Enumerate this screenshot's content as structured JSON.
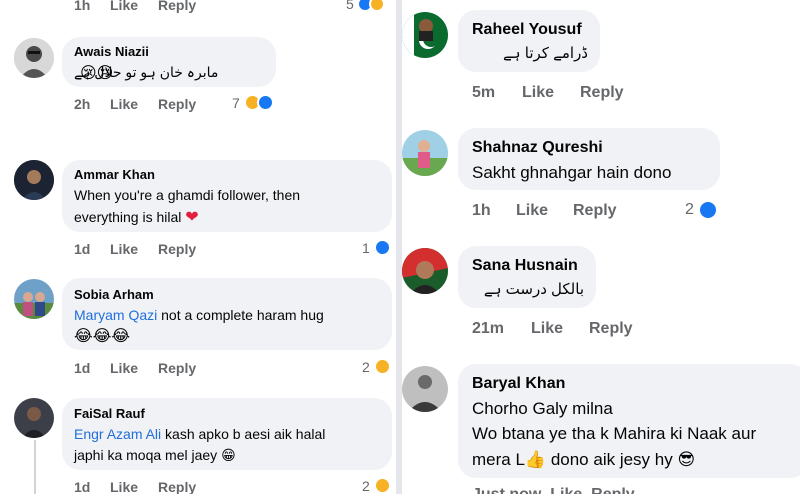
{
  "left": {
    "top_partial": {
      "time": "1h",
      "like": "Like",
      "reply": "Reply",
      "count": "5"
    },
    "comments": [
      {
        "author": "Awais Niazii",
        "text": "مابرہ خان ہو تو حلال ہے",
        "emoji_text": "😢😢",
        "time": "2h",
        "like": "Like",
        "reply": "Reply",
        "count": "7"
      },
      {
        "author": "Ammar Khan",
        "line1": "When you're a ghamdi follower, then",
        "line2": "everything is hilal",
        "heart": "❤",
        "time": "1d",
        "like": "Like",
        "reply": "Reply",
        "count": "1"
      },
      {
        "author": "Sobia Arham",
        "mention": "Maryam Qazi",
        "text": " not a complete haram hug",
        "emoji_text": "😂😂😂",
        "time": "1d",
        "like": "Like",
        "reply": "Reply",
        "count": "2"
      },
      {
        "author": "FaiSal Rauf",
        "mention": "Engr Azam Ali",
        "text": " kash apko b aesi aik halal",
        "line2": "japhi ka moqa mel jaey",
        "emoji_text": "😁",
        "time": "1d",
        "like": "Like",
        "reply": "Reply",
        "count": "2"
      }
    ]
  },
  "right": {
    "comments": [
      {
        "author": "Raheel Yousuf",
        "text": "ڈرامے کرتا ہے",
        "time": "5m",
        "like": "Like",
        "reply": "Reply"
      },
      {
        "author": "Shahnaz Qureshi",
        "text": "Sakht ghnahgar hain dono",
        "time": "1h",
        "like": "Like",
        "reply": "Reply",
        "count": "2"
      },
      {
        "author": "Sana Husnain",
        "text": "بالکل درست ہے",
        "time": "21m",
        "like": "Like",
        "reply": "Reply"
      },
      {
        "author": "Baryal Khan",
        "line1": "Chorho Galy milna",
        "line2": "Wo btana ye tha k Mahira ki Naak aur",
        "line3a": "mera L",
        "line3b": " dono aik jesy hy ",
        "finger": "👍",
        "emoji_text": "😎",
        "bottom_partial": "Just now  Like  Reply"
      }
    ]
  },
  "colors": {
    "like_blue": "#1877f2",
    "mention": "#216fdb",
    "bubble": "#f0f2f5",
    "meta": "#65676b"
  }
}
